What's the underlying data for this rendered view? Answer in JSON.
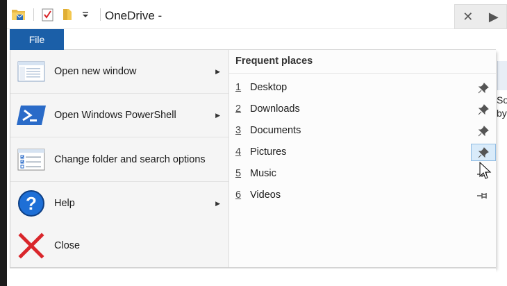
{
  "window": {
    "title": "OneDrive -"
  },
  "ribbon": {
    "file_tab_label": "File"
  },
  "file_menu": {
    "commands": [
      {
        "label": "Open new window",
        "has_submenu": true,
        "icon": "new-window-icon"
      },
      {
        "label": "Open Windows PowerShell",
        "has_submenu": true,
        "icon": "powershell-icon"
      },
      {
        "label": "Change folder and search options",
        "has_submenu": false,
        "icon": "folder-options-icon"
      },
      {
        "label": "Help",
        "has_submenu": true,
        "icon": "help-icon"
      },
      {
        "label": "Close",
        "has_submenu": false,
        "icon": "close-red-icon"
      }
    ],
    "frequent_places": {
      "title": "Frequent places",
      "items": [
        {
          "number": "1",
          "name": "Desktop",
          "pinned": true
        },
        {
          "number": "2",
          "name": "Downloads",
          "pinned": true
        },
        {
          "number": "3",
          "name": "Documents",
          "pinned": true
        },
        {
          "number": "4",
          "name": "Pictures",
          "pinned": true,
          "hovered": true
        },
        {
          "number": "5",
          "name": "Music",
          "pinned": false
        },
        {
          "number": "6",
          "name": "Videos",
          "pinned": false
        }
      ]
    }
  },
  "background": {
    "text_line1": "So",
    "text_line2": "by"
  },
  "colors": {
    "file_tab": "#1b5fa8",
    "pin_hover_bg": "#d9ebfa",
    "close_red": "#d9262b",
    "help_blue": "#1e6fd6"
  }
}
